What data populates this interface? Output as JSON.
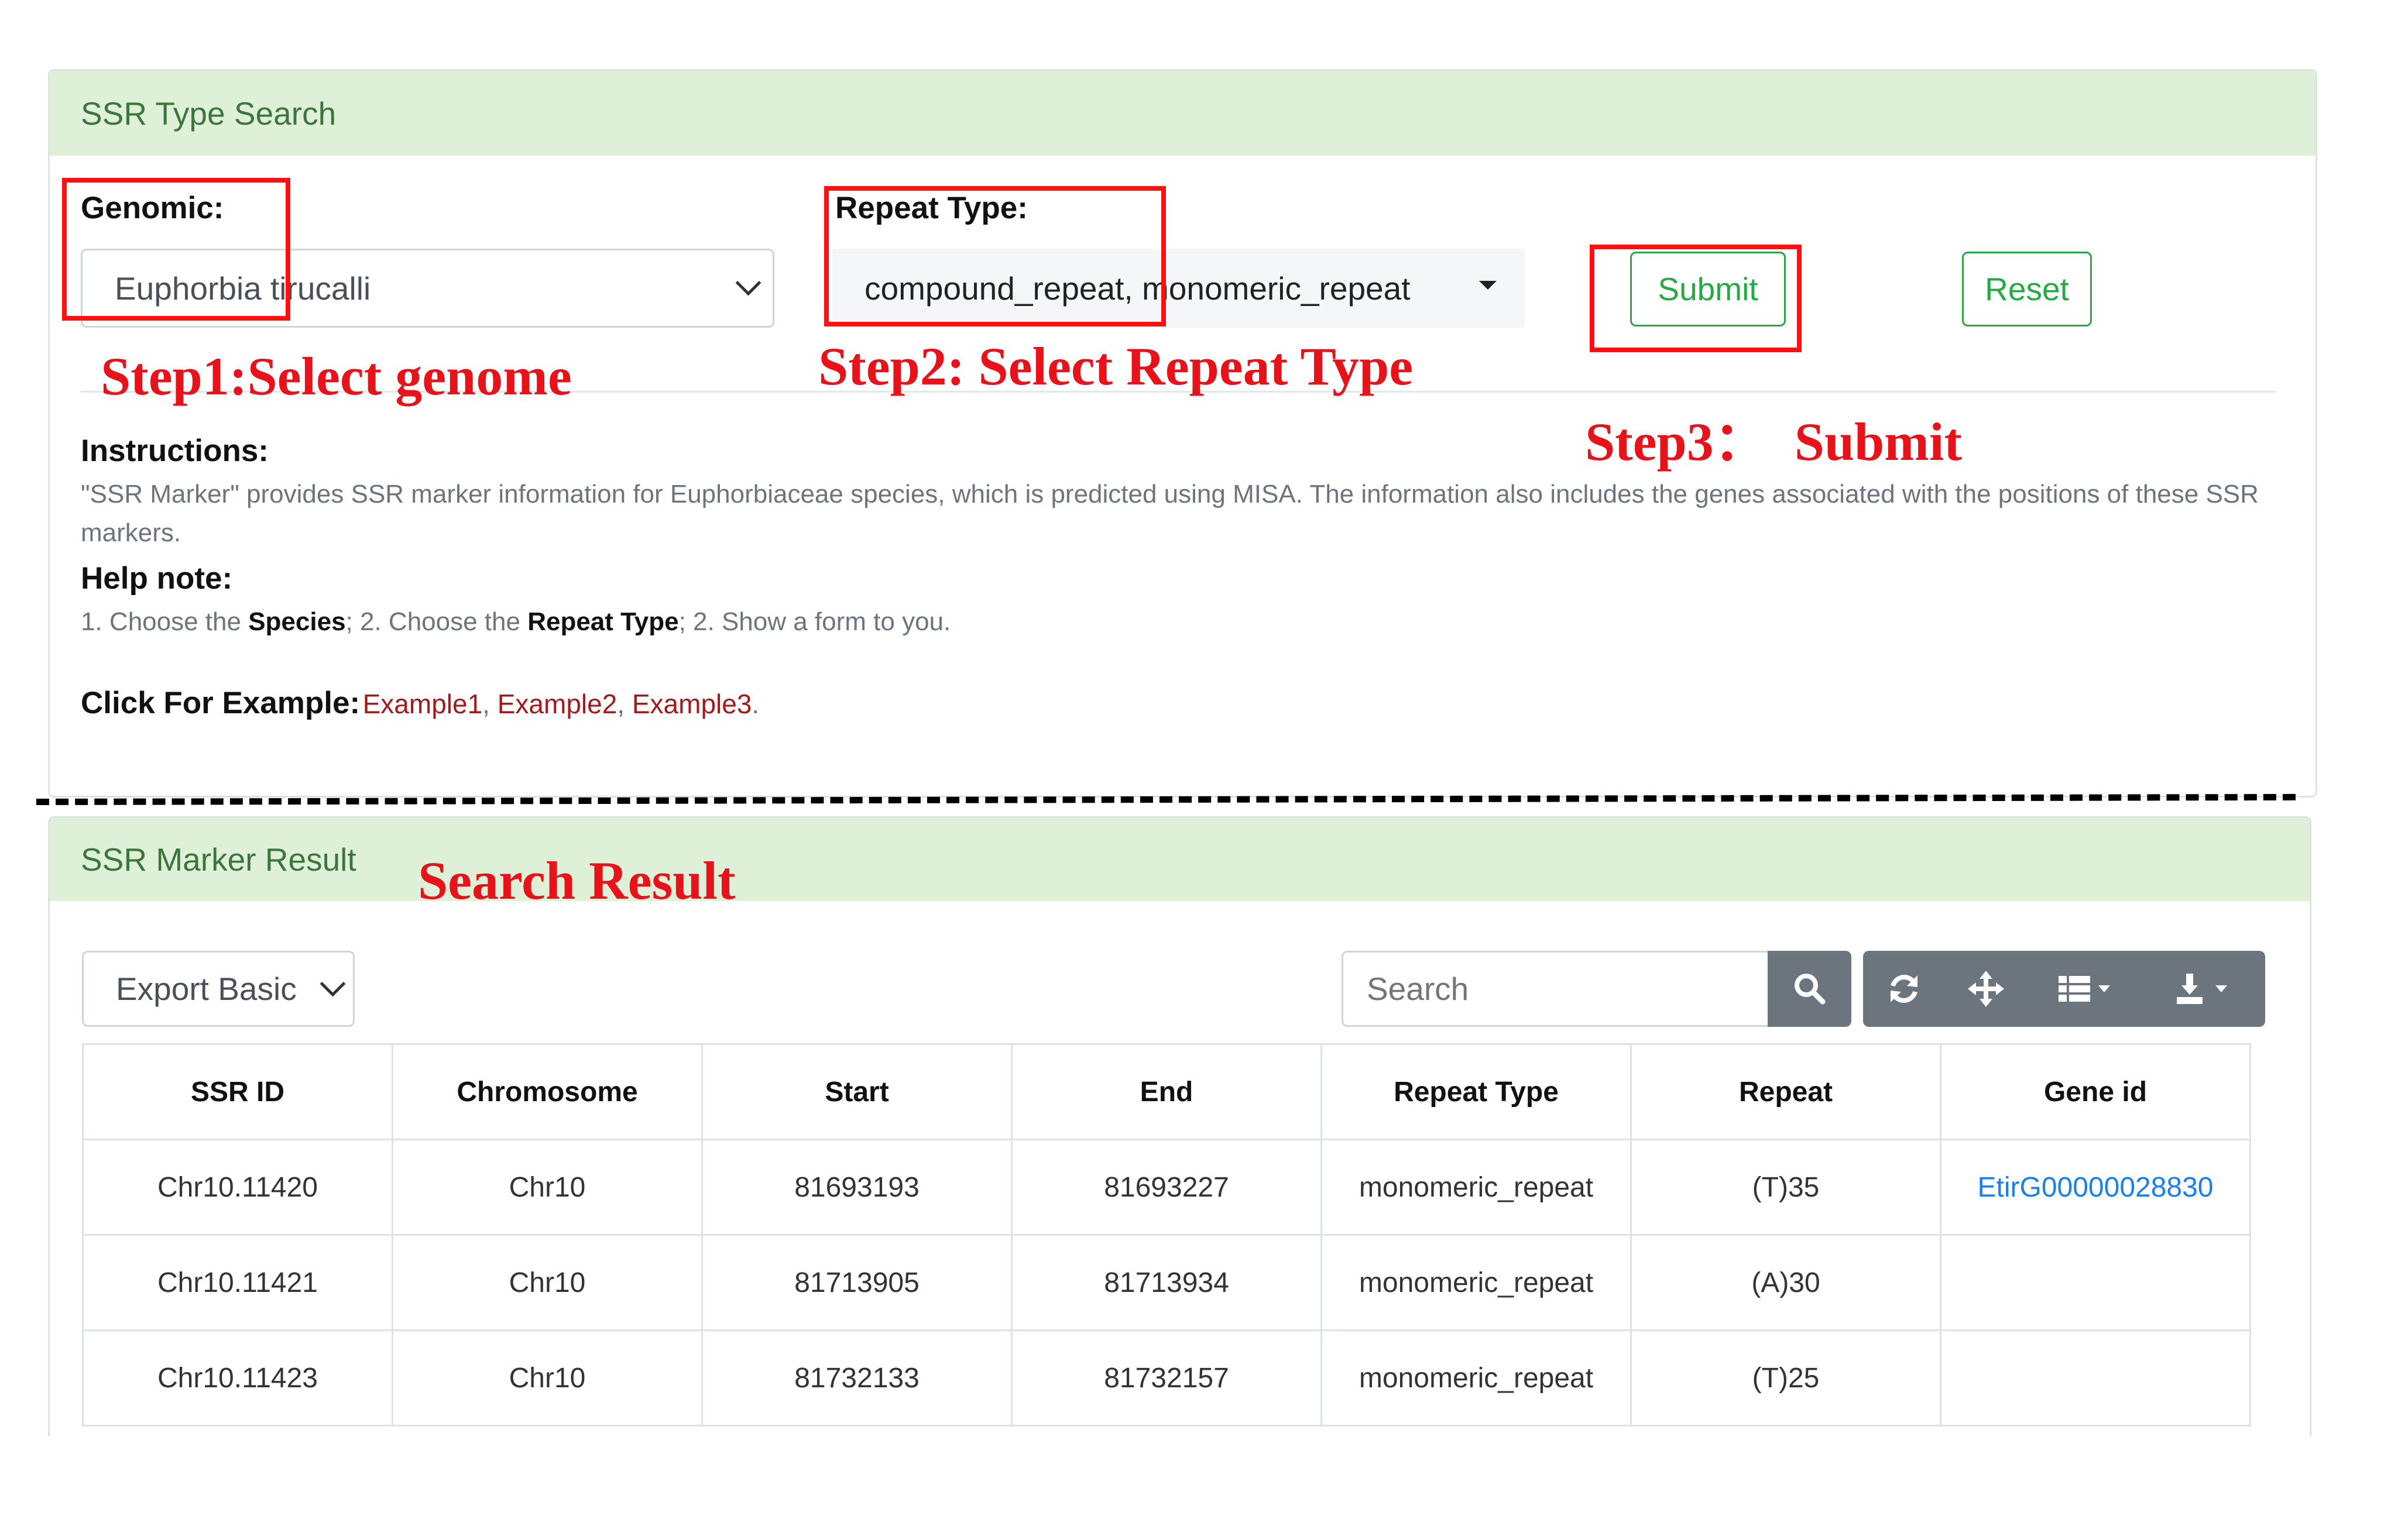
{
  "search_panel": {
    "title": "SSR Type Search",
    "genomic_label": "Genomic:",
    "genomic_value": "Euphorbia tirucalli",
    "repeat_type_label": "Repeat Type:",
    "repeat_type_value": "compound_repeat, monomeric_repeat",
    "submit_label": "Submit",
    "reset_label": "Reset",
    "instructions_title": "Instructions:",
    "instructions_text_line1": "\"SSR Marker\" provides SSR marker information for Euphorbiaceae species, which is predicted using MISA. The information also includes the genes associated with the positions of these SSR",
    "instructions_text_line2": "markers.",
    "help_title": "Help note:",
    "help": {
      "part1": "1. Choose the ",
      "species": "Species",
      "part2": "; 2. Choose the ",
      "repeat_type": "Repeat Type",
      "part3": "; 2. Show a form to you."
    },
    "example_title": "Click For Example:",
    "examples": [
      "Example1",
      "Example2",
      "Example3"
    ],
    "sep1": ", ",
    "sep2": ", ",
    "end": "."
  },
  "annotations": {
    "step1": "Step1:Select genome",
    "step2": "Step2: Select Repeat Type",
    "step3": "Step3：  Submit",
    "result": "Search Result"
  },
  "result_panel": {
    "title": "SSR Marker Result",
    "export_value": "Export Basic",
    "search_placeholder": "Search",
    "toolbar_icons": [
      "search-icon",
      "refresh-icon",
      "move-icon",
      "columns-icon",
      "download-icon"
    ]
  },
  "table": {
    "headers": [
      "SSR ID",
      "Chromosome",
      "Start",
      "End",
      "Repeat Type",
      "Repeat",
      "Gene id"
    ],
    "rows": [
      [
        "Chr10.11420",
        "Chr10",
        "81693193",
        "81693227",
        "monomeric_repeat",
        "(T)35",
        "EtirG00000028830"
      ],
      [
        "Chr10.11421",
        "Chr10",
        "81713905",
        "81713934",
        "monomeric_repeat",
        "(A)30",
        ""
      ],
      [
        "Chr10.11423",
        "Chr10",
        "81732133",
        "81732157",
        "monomeric_repeat",
        "(T)25",
        ""
      ]
    ]
  },
  "colors": {
    "header_bg": "#dff0d8",
    "header_text": "#3c763d",
    "success": "#28a745",
    "annotation": "#e8121a",
    "toolbar": "#6c757d",
    "link": "#1a7ff0",
    "example_link": "#a31a1a"
  }
}
